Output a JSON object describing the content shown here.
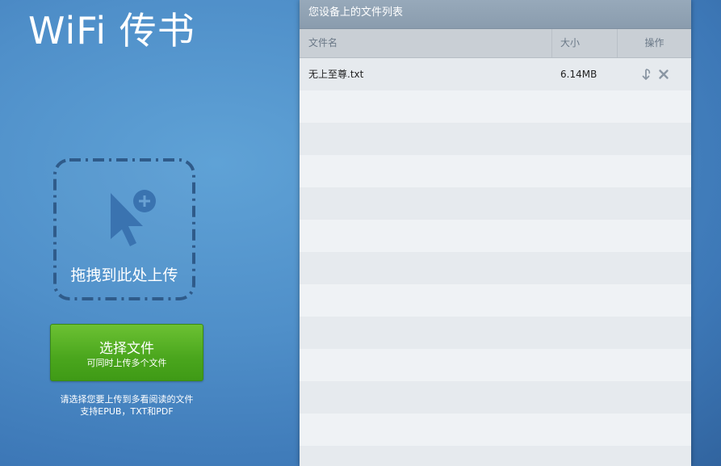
{
  "app": {
    "title": "WiFi 传书"
  },
  "upload": {
    "drop_text": "拖拽到此处上传",
    "choose_label": "选择文件",
    "choose_sub": "可同时上传多个文件",
    "hint_line1": "请选择您要上传到多看阅读的文件",
    "hint_line2": "支持EPUB，TXT和PDF"
  },
  "file_panel": {
    "header": "您设备上的文件列表",
    "columns": {
      "name": "文件名",
      "size": "大小",
      "actions": "操作"
    },
    "files": [
      {
        "name": "无上至尊.txt",
        "size": "6.14MB"
      }
    ]
  },
  "icons": {
    "drop": "cursor-plus-icon",
    "download": "download-icon",
    "delete": "close-icon"
  },
  "colors": {
    "accent_green": "#4aa61d",
    "background_blue": "#4f8fc9",
    "drop_zone_border": "#2f5b8a"
  }
}
